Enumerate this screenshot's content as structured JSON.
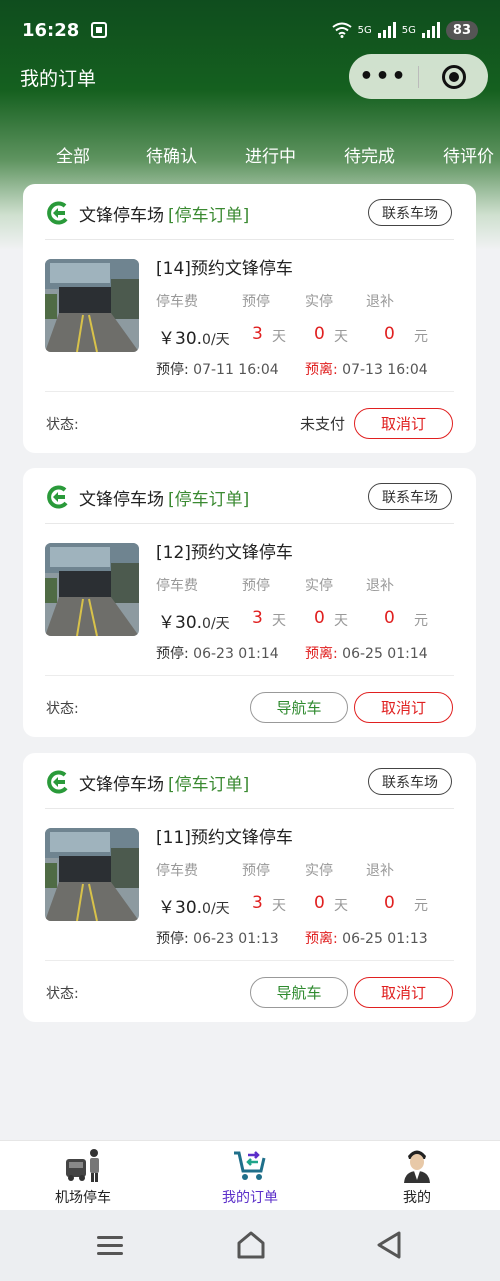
{
  "status_bar": {
    "time": "16:28",
    "signal_labels": [
      "5G",
      "5G"
    ],
    "battery": "83"
  },
  "header": {
    "title": "我的订单",
    "capsule_more": "•••",
    "capsule_target": "target-icon"
  },
  "tabs": [
    "全部",
    "待确认",
    "进行中",
    "待完成",
    "待评价"
  ],
  "orders": [
    {
      "lot_name": "文锋停车场",
      "order_type": "[停车订单]",
      "contact_label": "联系车场",
      "title": "[14]预约文锋停车",
      "col_fee": "停车费",
      "col_reserve": "预停",
      "col_actual": "实停",
      "col_refund": "退补",
      "price_main": "￥30.",
      "price_sub": "0/天",
      "reserve_days": "3",
      "actual_days": "0",
      "refund": "0",
      "day_unit": "天",
      "yuan_unit": "元",
      "start_label": "预停:",
      "start_time": "07-11 16:04",
      "end_label": "预离:",
      "end_time": "07-13 16:04",
      "status_label": "状态:",
      "status_value": "未支付",
      "cancel_label": "取消订",
      "nav_label": ""
    },
    {
      "lot_name": "文锋停车场",
      "order_type": "[停车订单]",
      "contact_label": "联系车场",
      "title": "[12]预约文锋停车",
      "col_fee": "停车费",
      "col_reserve": "预停",
      "col_actual": "实停",
      "col_refund": "退补",
      "price_main": "￥30.",
      "price_sub": "0/天",
      "reserve_days": "3",
      "actual_days": "0",
      "refund": "0",
      "day_unit": "天",
      "yuan_unit": "元",
      "start_label": "预停:",
      "start_time": "06-23 01:14",
      "end_label": "预离:",
      "end_time": "06-25 01:14",
      "status_label": "状态:",
      "status_value": "",
      "cancel_label": "取消订",
      "nav_label": "导航车"
    },
    {
      "lot_name": "文锋停车场",
      "order_type": "[停车订单]",
      "contact_label": "联系车场",
      "title": "[11]预约文锋停车",
      "col_fee": "停车费",
      "col_reserve": "预停",
      "col_actual": "实停",
      "col_refund": "退补",
      "price_main": "￥30.",
      "price_sub": "0/天",
      "reserve_days": "3",
      "actual_days": "0",
      "refund": "0",
      "day_unit": "天",
      "yuan_unit": "元",
      "start_label": "预停:",
      "start_time": "06-23 01:13",
      "end_label": "预离:",
      "end_time": "06-25 01:13",
      "status_label": "状态:",
      "status_value": "",
      "cancel_label": "取消订",
      "nav_label": "导航车"
    }
  ],
  "tabbar": [
    {
      "label": "机场停车",
      "icon": "car-person-icon",
      "active": false
    },
    {
      "label": "我的订单",
      "icon": "cart-icon",
      "active": true
    },
    {
      "label": "我的",
      "icon": "profile-icon",
      "active": false
    }
  ],
  "colors": {
    "header_green": "#15601f",
    "accent_green": "#3b8a32",
    "danger_red": "#e02020",
    "active_tab_purple": "#5b2fc9"
  }
}
